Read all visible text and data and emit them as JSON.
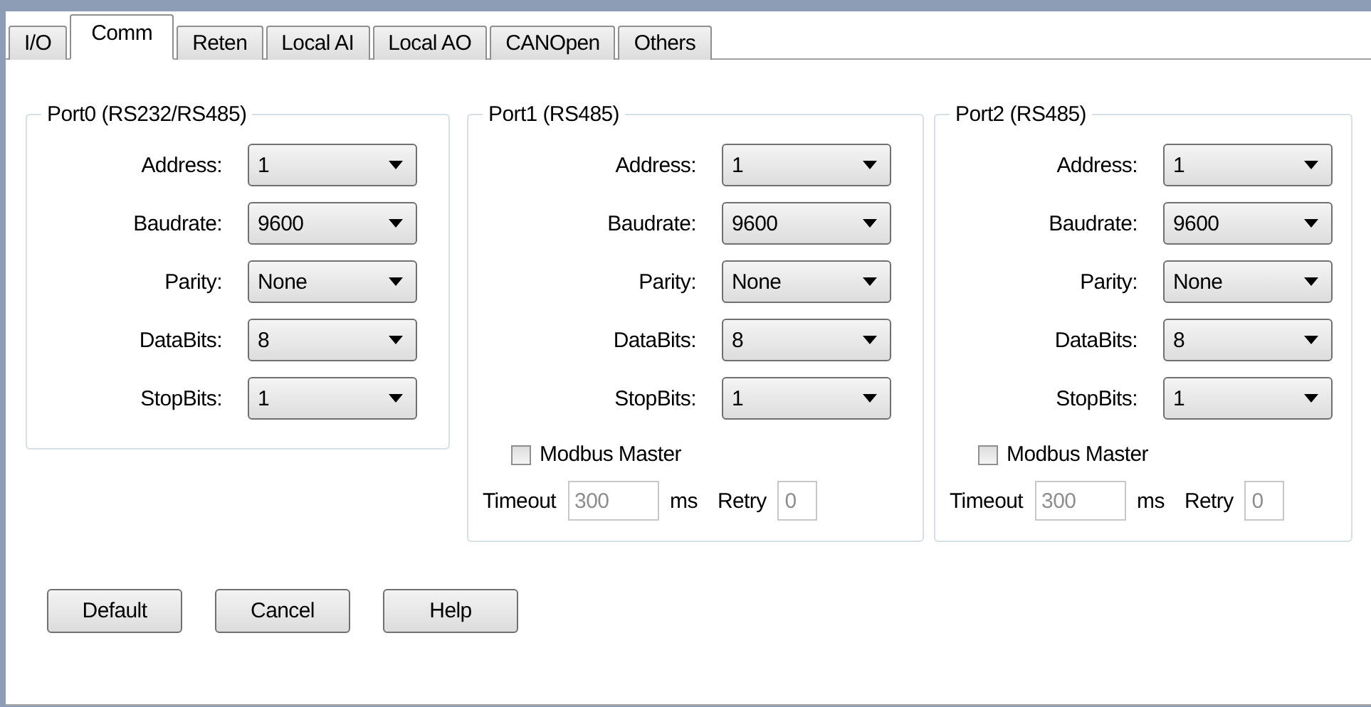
{
  "tabs": [
    {
      "label": "I/O",
      "selected": false
    },
    {
      "label": "Comm",
      "selected": true
    },
    {
      "label": "Reten",
      "selected": false
    },
    {
      "label": "Local AI",
      "selected": false
    },
    {
      "label": "Local AO",
      "selected": false
    },
    {
      "label": "CANOpen",
      "selected": false
    },
    {
      "label": "Others",
      "selected": false
    }
  ],
  "ports": [
    {
      "title": "Port0 (RS232/RS485)",
      "fields": [
        {
          "label": "Address:",
          "value": "1"
        },
        {
          "label": "Baudrate:",
          "value": "9600"
        },
        {
          "label": "Parity:",
          "value": "None"
        },
        {
          "label": "DataBits:",
          "value": "8"
        },
        {
          "label": "StopBits:",
          "value": "1"
        }
      ]
    },
    {
      "title": "Port1 (RS485)",
      "fields": [
        {
          "label": "Address:",
          "value": "1"
        },
        {
          "label": "Baudrate:",
          "value": "9600"
        },
        {
          "label": "Parity:",
          "value": "None"
        },
        {
          "label": "DataBits:",
          "value": "8"
        },
        {
          "label": "StopBits:",
          "value": "1"
        }
      ],
      "modbus": {
        "label": "Modbus Master",
        "checked": false
      },
      "timeout": {
        "label": "Timeout",
        "value": "300",
        "unit": "ms",
        "disabled": true
      },
      "retry": {
        "label": "Retry",
        "value": "0",
        "disabled": true
      }
    },
    {
      "title": "Port2 (RS485)",
      "fields": [
        {
          "label": "Address:",
          "value": "1"
        },
        {
          "label": "Baudrate:",
          "value": "9600"
        },
        {
          "label": "Parity:",
          "value": "None"
        },
        {
          "label": "DataBits:",
          "value": "8"
        },
        {
          "label": "StopBits:",
          "value": "1"
        }
      ],
      "modbus": {
        "label": "Modbus Master",
        "checked": false
      },
      "timeout": {
        "label": "Timeout",
        "value": "300",
        "unit": "ms",
        "disabled": true
      },
      "retry": {
        "label": "Retry",
        "value": "0",
        "disabled": true
      }
    }
  ],
  "buttons": [
    "Default",
    "Cancel",
    "Help"
  ]
}
